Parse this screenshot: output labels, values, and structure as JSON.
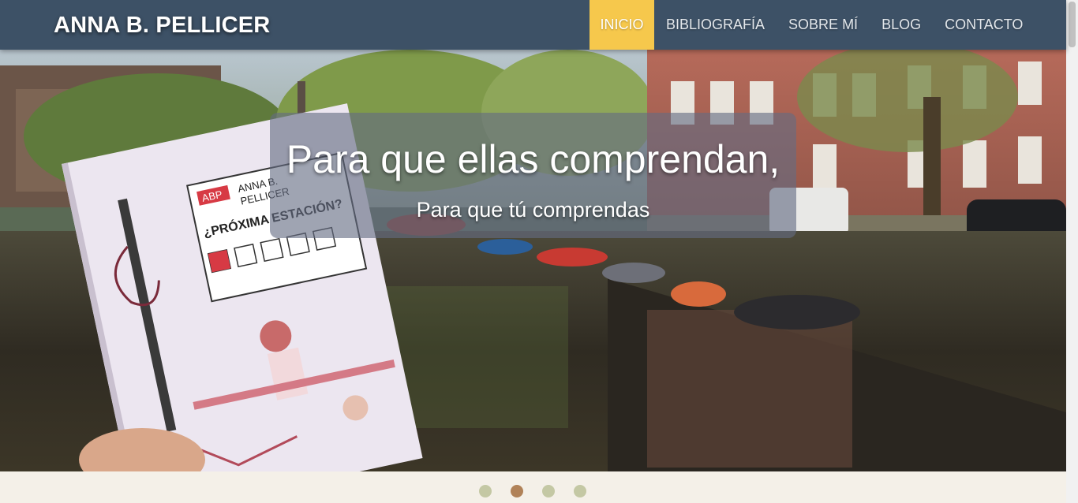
{
  "brand": {
    "title": "ANNA B. PELLICER"
  },
  "nav": {
    "items": [
      {
        "label": "INICIO",
        "active": true
      },
      {
        "label": "BIBLIOGRAFÍA",
        "active": false
      },
      {
        "label": "SOBRE MÍ",
        "active": false
      },
      {
        "label": "BLOG",
        "active": false
      },
      {
        "label": "CONTACTO",
        "active": false
      }
    ]
  },
  "hero": {
    "title": "Para que ellas comprendan,",
    "subtitle": "Para que tú comprendas",
    "book": {
      "logo": "ABP",
      "author_line1": "ANNA B.",
      "author_line2": "PELLICER",
      "title": "¿PRÓXIMA ESTACIÓN?"
    }
  },
  "carousel": {
    "slides": 4,
    "active_index": 1
  },
  "colors": {
    "navbar": "#3d5166",
    "accent": "#f6c84c",
    "dot": "#c4c8a4",
    "dot_active": "#b08258",
    "footer": "#f4f0e8"
  }
}
